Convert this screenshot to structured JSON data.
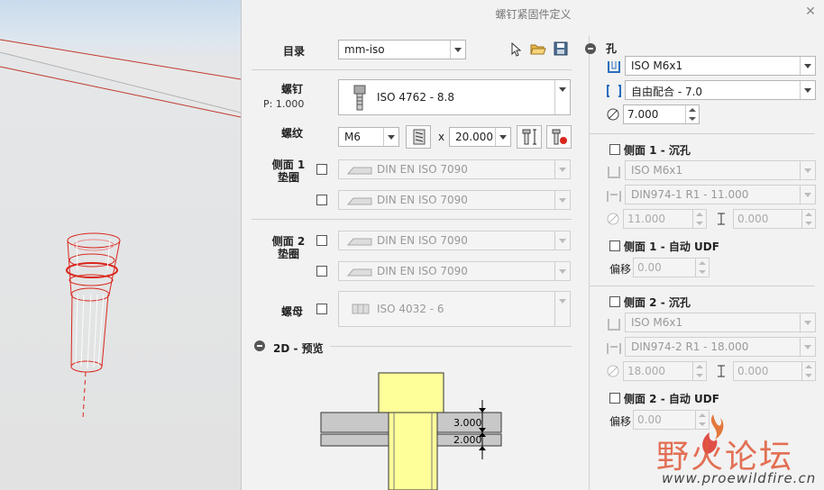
{
  "dialog": {
    "title": "螺钉紧固件定义"
  },
  "left": {
    "catalog_label": "目录",
    "catalog_value": "mm-iso",
    "screw_label": "螺钉",
    "screw_p": "P: 1.000",
    "screw_value": "ISO 4762 - 8.8",
    "thread_label": "螺纹",
    "thread_size": "M6",
    "x_sep": "x",
    "thread_length": "20.000",
    "side1_washer_label": "侧面 1\n垫圈",
    "side1_washer_1": "DIN EN ISO 7090",
    "side1_washer_2": "DIN EN ISO 7090",
    "side2_washer_label": "侧面 2\n垫圈",
    "side2_washer_1": "DIN EN ISO 7090",
    "side2_washer_2": "DIN EN ISO 7090",
    "nut_label": "螺母",
    "nut_value": "ISO 4032 - 6",
    "preview_label": "2D - 预览",
    "dim_1": "3.000",
    "dim_2": "2.000"
  },
  "right": {
    "hole_label": "孔",
    "hole_value": "ISO M6x1",
    "fit_value": "自由配合 - 7.0",
    "diameter": "7.000",
    "side1_cs_label": "侧面 1 - 沉孔",
    "side1_cs_hole": "ISO M6x1",
    "side1_cs_std": "DIN974-1 R1 - 11.000",
    "side1_cs_dia": "11.000",
    "side1_cs_depth": "0.000",
    "side1_udf_label": "侧面 1 - 自动 UDF",
    "offset_label_1": "偏移",
    "offset_1": "0.00",
    "side2_cs_label": "侧面 2 - 沉孔",
    "side2_cs_hole": "ISO M6x1",
    "side2_cs_std": "DIN974-2 R1 - 18.000",
    "side2_cs_dia": "18.000",
    "side2_cs_depth": "0.000",
    "side2_udf_label": "侧面 2 - 自动 UDF",
    "offset_label_2": "偏移",
    "offset_2": "0.00"
  },
  "watermark": {
    "title": "野火论坛",
    "url": "www.proewildfire.cn"
  },
  "colors": {
    "accent_red": "#d9261c",
    "preview_yellow": "#ffff9a",
    "preview_gray": "#c8c8c8"
  }
}
